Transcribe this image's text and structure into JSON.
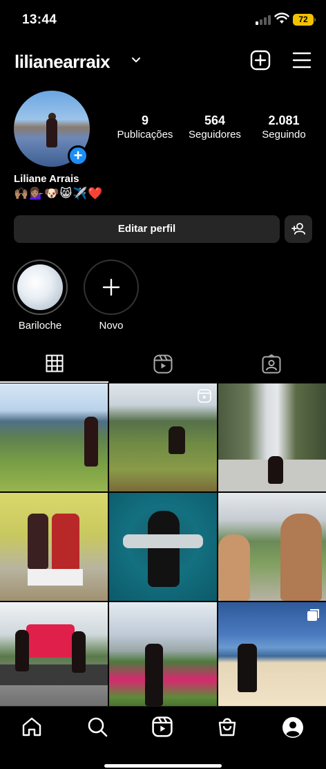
{
  "status_bar": {
    "time": "13:44",
    "battery": "72"
  },
  "header": {
    "username": "lilianearraix"
  },
  "profile": {
    "name": "Liliane Arrais",
    "bio": "🙌🏽💁🏽‍♀️🐶😸✈️❤️",
    "stats": [
      {
        "value": "9",
        "label": "Publicações"
      },
      {
        "value": "564",
        "label": "Seguidores"
      },
      {
        "value": "2.081",
        "label": "Seguindo"
      }
    ],
    "edit_label": "Editar perfil"
  },
  "highlights": [
    {
      "label": "Bariloche"
    },
    {
      "label": "Novo"
    }
  ],
  "tiles": [
    {
      "name": "post-mountain-view"
    },
    {
      "name": "post-swing-reel"
    },
    {
      "name": "post-canyon-road"
    },
    {
      "name": "post-birthday-party"
    },
    {
      "name": "post-scuba-diving"
    },
    {
      "name": "post-beach-selfie"
    },
    {
      "name": "post-pomerode-sign"
    },
    {
      "name": "post-botanical-garden"
    },
    {
      "name": "post-sand-dunes"
    }
  ]
}
